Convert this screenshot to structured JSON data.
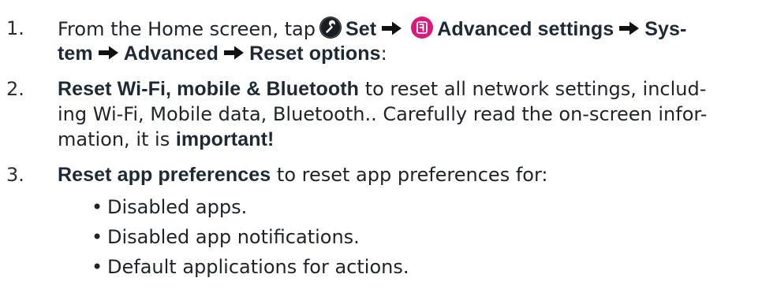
{
  "steps": [
    {
      "number": "1.",
      "line1_pre": "From the Home screen, tap",
      "set_label": "Set",
      "advanced_settings_label": "Advanced settings",
      "system_label_part1": "Sys-",
      "system_label_part2": "tem",
      "advanced_label": "Advanced",
      "reset_options_label": "Reset options",
      "trailing": ":"
    },
    {
      "number": "2.",
      "bold_label": "Reset Wi-Fi, mobile & Bluetooth",
      "line1_rest": "to reset all network settings, includ-",
      "line2": "ing Wi-Fi, Mobile data, Bluetooth.. Carefully read the on-screen infor-",
      "line3_pre": "mation, it is",
      "important_label": "important!"
    },
    {
      "number": "3.",
      "bold_label": "Reset app preferences",
      "rest": "to reset app preferences for:"
    }
  ],
  "bullets": [
    "Disabled apps.",
    "Disabled app notifications.",
    "Default applications for actions."
  ],
  "bullet_glyph": "•",
  "icons": {
    "set": "wrench-icon",
    "advanced_settings": "advanced-settings-icon",
    "arrow": "right-arrow-icon"
  },
  "colors": {
    "text": "#1f2329",
    "keyword": "#1d2a36",
    "set_icon_bg": "#1a1d22",
    "advanced_icon_bg": "#d81b7a"
  }
}
